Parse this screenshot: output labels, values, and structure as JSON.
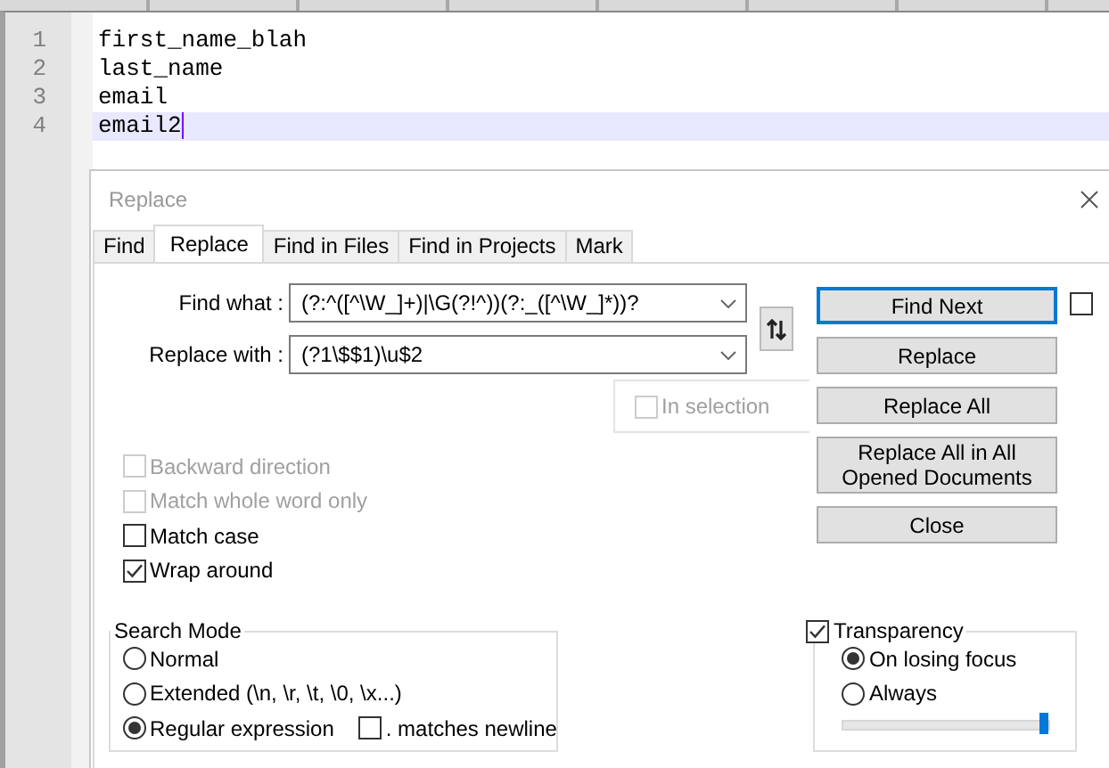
{
  "editor": {
    "lines": [
      {
        "number": "1",
        "text": "first_name_blah",
        "current": false
      },
      {
        "number": "2",
        "text": "last_name",
        "current": false
      },
      {
        "number": "3",
        "text": "email",
        "current": false
      },
      {
        "number": "4",
        "text": "email2",
        "current": true
      }
    ]
  },
  "dialog": {
    "title": "Replace",
    "tabs": [
      {
        "label": "Find",
        "selected": false
      },
      {
        "label": "Replace",
        "selected": true
      },
      {
        "label": "Find in Files",
        "selected": false
      },
      {
        "label": "Find in Projects",
        "selected": false
      },
      {
        "label": "Mark",
        "selected": false
      }
    ],
    "fields": [
      {
        "label": "Find what :",
        "value": "(?:^([^\\W_]+)|\\G(?!^))(?:_([^\\W_]*))?"
      },
      {
        "label": "Replace with :",
        "value": "(?1\\$$1)\\u$2"
      }
    ],
    "in_selection": {
      "label": "In selection",
      "checked": false,
      "disabled": true
    },
    "buttons": [
      {
        "label": "Find Next",
        "focused": true
      },
      {
        "label": "Replace",
        "focused": false
      },
      {
        "label": "Replace All",
        "focused": false
      },
      {
        "label": "Replace All in All Opened Documents",
        "focused": false
      },
      {
        "label": "Close",
        "focused": false
      }
    ],
    "side_checkbox": {
      "checked": false
    },
    "options": [
      {
        "label": "Backward direction",
        "checked": false,
        "disabled": true
      },
      {
        "label": "Match whole word only",
        "checked": false,
        "disabled": true
      },
      {
        "label": "Match case",
        "checked": false,
        "disabled": false
      },
      {
        "label": "Wrap around",
        "checked": true,
        "disabled": false
      }
    ],
    "search_mode": {
      "title": "Search Mode",
      "options": [
        {
          "label": "Normal",
          "selected": false
        },
        {
          "label": "Extended (\\n, \\r, \\t, \\0, \\x...)",
          "selected": false
        },
        {
          "label": "Regular expression",
          "selected": true
        }
      ],
      "dot_matches_newline": {
        "label": ". matches newline",
        "checked": false
      }
    },
    "transparency": {
      "label": "Transparency",
      "checked": true,
      "options": [
        {
          "label": "On losing focus",
          "selected": true
        },
        {
          "label": "Always",
          "selected": false
        }
      ],
      "level": 1
    }
  }
}
